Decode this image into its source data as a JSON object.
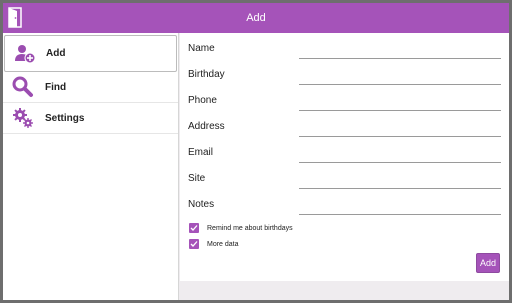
{
  "window": {
    "title": "Add"
  },
  "sidebar": {
    "items": [
      {
        "label": "Add",
        "icon": "add-contact-icon"
      },
      {
        "label": "Find",
        "icon": "magnifier-icon"
      },
      {
        "label": "Settings",
        "icon": "gears-icon"
      }
    ]
  },
  "form": {
    "fields": [
      {
        "label": "Name",
        "value": ""
      },
      {
        "label": "Birthday",
        "value": ""
      },
      {
        "label": "Phone",
        "value": ""
      },
      {
        "label": "Address",
        "value": ""
      },
      {
        "label": "Email",
        "value": ""
      },
      {
        "label": "Site",
        "value": ""
      },
      {
        "label": "Notes",
        "value": ""
      }
    ],
    "checkboxes": [
      {
        "label": "Remind me about birthdays",
        "checked": true
      },
      {
        "label": "More data",
        "checked": true
      }
    ],
    "submit_label": "Add"
  },
  "colors": {
    "accent": "#a553b9"
  }
}
